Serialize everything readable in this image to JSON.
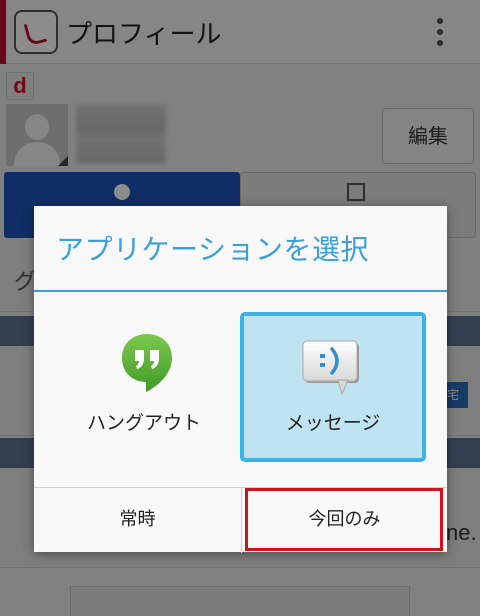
{
  "background": {
    "title": "プロフィール",
    "edit_button": "編集",
    "brand_logo": "d",
    "row_initial": "グ",
    "tag_text": "宅",
    "partial_text": "ne.",
    "icons": [
      "phone-app-icon",
      "overflow-menu-icon",
      "avatar-icon",
      "person-icon",
      "contact-card-icon",
      "phone-icon",
      "mail-icon"
    ]
  },
  "dialog": {
    "title": "アプリケーションを選択",
    "options": [
      {
        "label": "ハングアウト",
        "icon": "hangouts-icon",
        "selected": false
      },
      {
        "label": "メッセージ",
        "icon": "message-icon",
        "selected": true
      }
    ],
    "buttons": {
      "always": "常時",
      "just_once": "今回のみ"
    }
  },
  "colors": {
    "accent": "#3aa0d8",
    "selection_fill": "#bfe3f1",
    "selection_border": "#3bb3e3",
    "highlight": "#d0121e",
    "hangouts_green": "#5ab83a"
  }
}
